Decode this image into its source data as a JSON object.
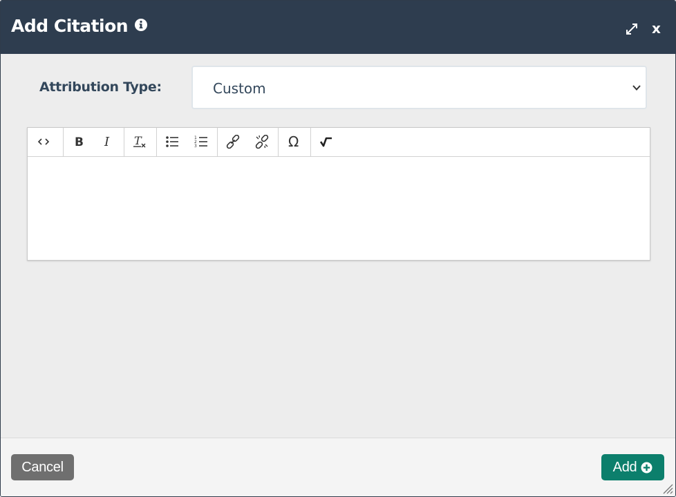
{
  "dialog": {
    "title": "Add Citation",
    "info_icon": "info-circle-icon",
    "expand_icon": "expand-arrows-icon",
    "close_label": "x"
  },
  "form": {
    "attribution_label": "Attribution Type:",
    "attribution_value": "Custom"
  },
  "toolbar": {
    "buttons": [
      {
        "name": "source-code",
        "icon": "code-brackets-icon"
      },
      {
        "name": "bold",
        "icon": "bold-icon"
      },
      {
        "name": "italic",
        "icon": "italic-icon"
      },
      {
        "name": "remove-format",
        "icon": "clear-format-icon"
      },
      {
        "name": "bulleted-list",
        "icon": "bulleted-list-icon"
      },
      {
        "name": "numbered-list",
        "icon": "numbered-list-icon"
      },
      {
        "name": "link",
        "icon": "link-icon"
      },
      {
        "name": "unlink",
        "icon": "unlink-icon"
      },
      {
        "name": "special-character",
        "icon": "omega-icon"
      },
      {
        "name": "math",
        "icon": "square-root-icon"
      }
    ]
  },
  "editor": {
    "content": ""
  },
  "footer": {
    "cancel_label": "Cancel",
    "add_label": "Add",
    "add_icon": "plus-circle-icon"
  },
  "colors": {
    "titlebar": "#2e3d4f",
    "add_button": "#0c7f6c",
    "cancel_button": "#6f6f6f",
    "label_text": "#33475b"
  }
}
